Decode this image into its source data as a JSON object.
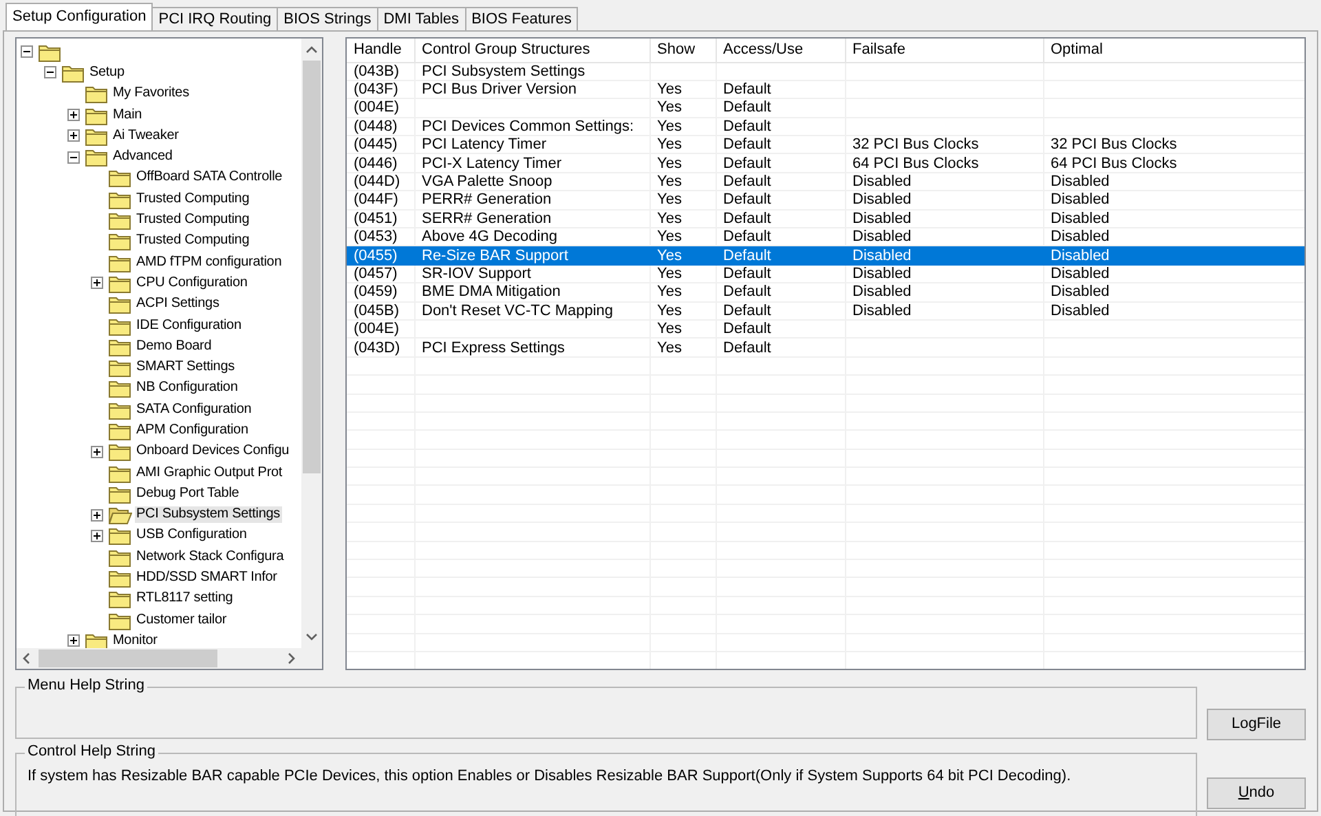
{
  "tabs": [
    {
      "label": "Setup Configuration",
      "selected": true
    },
    {
      "label": "PCI IRQ Routing",
      "selected": false
    },
    {
      "label": "BIOS Strings",
      "selected": false
    },
    {
      "label": "DMI Tables",
      "selected": false
    },
    {
      "label": "BIOS Features",
      "selected": false
    }
  ],
  "tree": {
    "expanded": true,
    "children": [
      {
        "label": "Setup",
        "expanded": true,
        "selected": false,
        "children": [
          {
            "label": "My Favorites",
            "selected": false
          },
          {
            "label": "Main",
            "expanded": false,
            "selected": false
          },
          {
            "label": "Ai Tweaker",
            "expanded": false,
            "selected": false
          },
          {
            "label": "Advanced",
            "expanded": true,
            "selected": false,
            "children": [
              {
                "label": "OffBoard SATA Controlle",
                "selected": false
              },
              {
                "label": "Trusted Computing",
                "selected": false
              },
              {
                "label": "Trusted Computing",
                "selected": false
              },
              {
                "label": "Trusted Computing",
                "selected": false
              },
              {
                "label": "AMD fTPM configuration",
                "selected": false
              },
              {
                "label": "CPU Configuration",
                "expanded": false,
                "selected": false
              },
              {
                "label": "ACPI Settings",
                "selected": false
              },
              {
                "label": "IDE Configuration",
                "selected": false
              },
              {
                "label": "Demo Board",
                "selected": false
              },
              {
                "label": "SMART Settings",
                "selected": false
              },
              {
                "label": "NB Configuration",
                "selected": false
              },
              {
                "label": "SATA Configuration",
                "selected": false
              },
              {
                "label": "APM Configuration",
                "selected": false
              },
              {
                "label": "Onboard Devices Configu",
                "expanded": false,
                "selected": false
              },
              {
                "label": "AMI Graphic Output Prot",
                "selected": false
              },
              {
                "label": "Debug Port Table",
                "selected": false
              },
              {
                "label": "PCI Subsystem Settings",
                "expanded": false,
                "selected": true
              },
              {
                "label": "USB Configuration",
                "expanded": false,
                "selected": false
              },
              {
                "label": "Network Stack Configura",
                "selected": false
              },
              {
                "label": "HDD/SSD SMART Infor",
                "selected": false
              },
              {
                "label": "RTL8117 setting",
                "selected": false
              },
              {
                "label": "Customer tailor",
                "selected": false
              }
            ]
          },
          {
            "label": "Monitor",
            "expanded": false,
            "selected": false
          }
        ]
      }
    ]
  },
  "table": {
    "columns": [
      "Handle",
      "Control Group Structures",
      "Show",
      "Access/Use",
      "Failsafe",
      "Optimal"
    ],
    "rows": [
      {
        "handle": "(043B)",
        "name": "PCI Subsystem Settings",
        "selected": false
      },
      {
        "handle": "(043F)",
        "name": "PCI Bus Driver Version",
        "show": "Yes",
        "access": "Default",
        "selected": false
      },
      {
        "handle": "(004E)",
        "show": "Yes",
        "access": "Default",
        "selected": false
      },
      {
        "handle": "(0448)",
        "name": "PCI Devices Common Settings:",
        "show": "Yes",
        "access": "Default",
        "selected": false
      },
      {
        "handle": "(0445)",
        "name": "PCI Latency Timer",
        "show": "Yes",
        "access": "Default",
        "failsafe": "32 PCI Bus Clocks",
        "optimal": "32 PCI Bus Clocks",
        "selected": false
      },
      {
        "handle": "(0446)",
        "name": "PCI-X Latency Timer",
        "show": "Yes",
        "access": "Default",
        "failsafe": "64 PCI Bus Clocks",
        "optimal": "64 PCI Bus Clocks",
        "selected": false
      },
      {
        "handle": "(044D)",
        "name": "VGA Palette Snoop",
        "show": "Yes",
        "access": "Default",
        "failsafe": "Disabled",
        "optimal": "Disabled",
        "selected": false
      },
      {
        "handle": "(044F)",
        "name": "PERR# Generation",
        "show": "Yes",
        "access": "Default",
        "failsafe": "Disabled",
        "optimal": "Disabled",
        "selected": false
      },
      {
        "handle": "(0451)",
        "name": "SERR# Generation",
        "show": "Yes",
        "access": "Default",
        "failsafe": "Disabled",
        "optimal": "Disabled",
        "selected": false
      },
      {
        "handle": "(0453)",
        "name": "Above 4G Decoding",
        "show": "Yes",
        "access": "Default",
        "failsafe": "Disabled",
        "optimal": "Disabled",
        "selected": false
      },
      {
        "handle": "(0455)",
        "name": "Re-Size BAR Support",
        "show": "Yes",
        "access": "Default",
        "failsafe": "Disabled",
        "optimal": "Disabled",
        "selected": true
      },
      {
        "handle": "(0457)",
        "name": "SR-IOV Support",
        "show": "Yes",
        "access": "Default",
        "failsafe": "Disabled",
        "optimal": "Disabled",
        "selected": false
      },
      {
        "handle": "(0459)",
        "name": "BME DMA Mitigation",
        "show": "Yes",
        "access": "Default",
        "failsafe": "Disabled",
        "optimal": "Disabled",
        "selected": false
      },
      {
        "handle": "(045B)",
        "name": "Don't Reset VC-TC Mapping",
        "show": "Yes",
        "access": "Default",
        "failsafe": "Disabled",
        "optimal": "Disabled",
        "selected": false
      },
      {
        "handle": "(004E)",
        "show": "Yes",
        "access": "Default",
        "selected": false
      },
      {
        "handle": "(043D)",
        "name": "PCI Express Settings",
        "show": "Yes",
        "access": "Default",
        "selected": false
      }
    ]
  },
  "menu_help": {
    "title": "Menu Help String"
  },
  "control_help": {
    "title": "Control Help String",
    "text": "If system has Resizable BAR capable PCIe Devices, this option Enables or Disables Resizable BAR Support(Only if System Supports 64 bit PCI Decoding)."
  },
  "buttons": [
    "LogFile",
    "Undo"
  ]
}
